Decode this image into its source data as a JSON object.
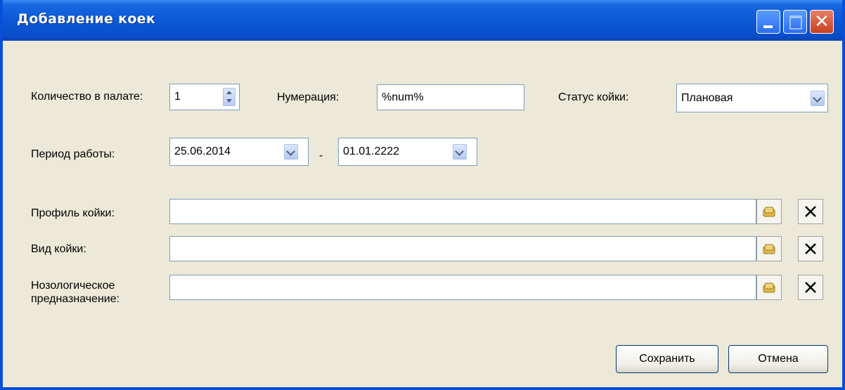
{
  "window": {
    "title": "Добавление коек"
  },
  "form": {
    "count_label": "Количество в палате:",
    "count_value": "1",
    "numbering_label": "Нумерация:",
    "numbering_value": "%num%",
    "status_label": "Статус койки:",
    "status_value": "Плановая",
    "period_label": "Период работы:",
    "period_from": "25.06.2014",
    "period_separator": "-",
    "period_to": "01.01.2222",
    "profile_label": "Профиль койки:",
    "profile_value": "",
    "kind_label": "Вид койки:",
    "kind_value": "",
    "nosology_label": "Нозологическое предназначение:",
    "nosology_value": ""
  },
  "buttons": {
    "save": "Сохранить",
    "cancel": "Отмена"
  },
  "icons": {
    "minimize": "minimize-icon",
    "maximize": "maximize-icon",
    "close": "close-icon",
    "lookup": "folder-lookup-icon",
    "clear": "clear-x-icon",
    "dropdown": "chevron-down-icon",
    "spinner": "spinner-arrows-icon"
  }
}
